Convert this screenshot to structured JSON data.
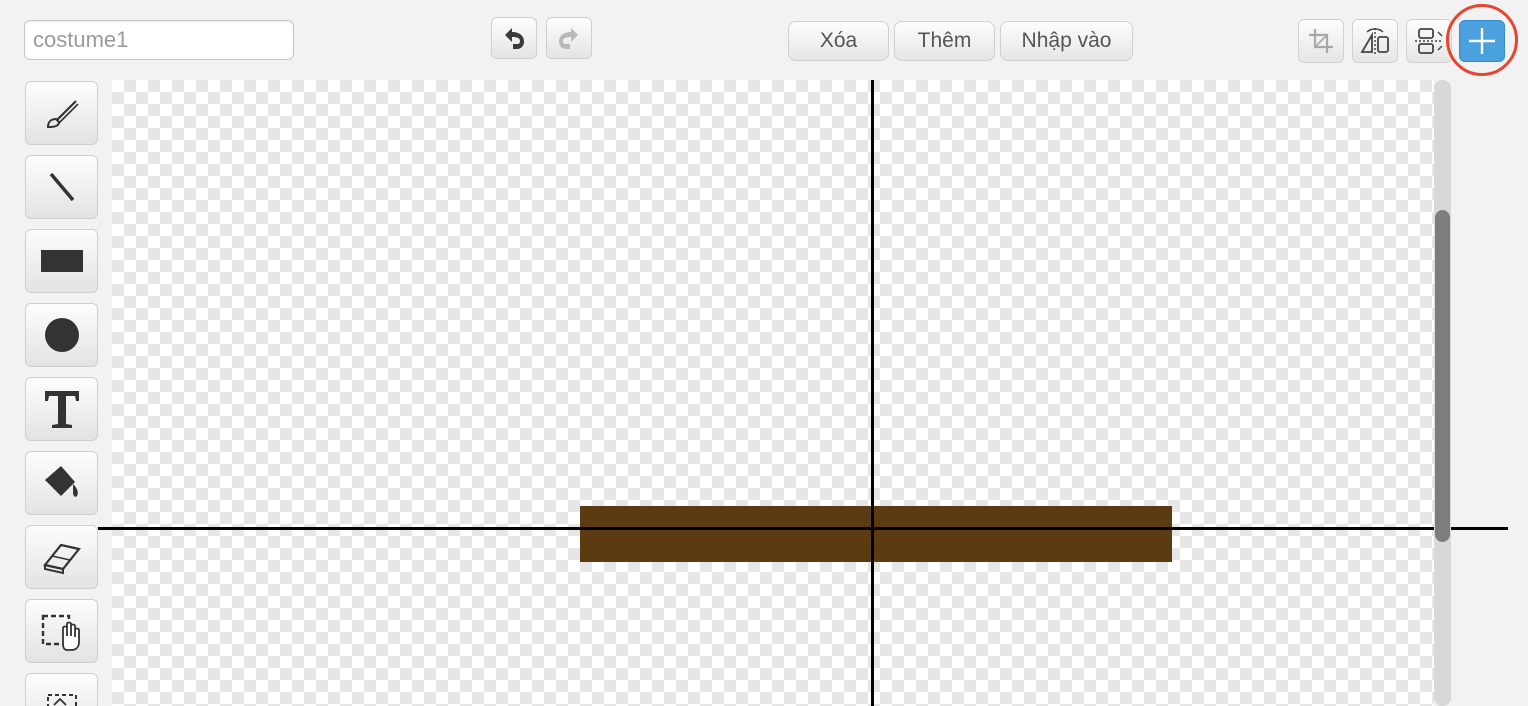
{
  "costume": {
    "name_value": "costume1",
    "name_placeholder": "costume1"
  },
  "history": {
    "undo_icon": "undo-arrow-icon",
    "redo_icon": "redo-arrow-icon"
  },
  "actions": {
    "clear_label": "Xóa",
    "add_label": "Thêm",
    "import_label": "Nhập vào"
  },
  "transform_tools": {
    "crop_icon": "crop-icon",
    "flip_horizontal_icon": "flip-horizontal-icon",
    "flip_vertical_icon": "flip-vertical-icon",
    "set_center_icon": "crosshair-icon",
    "set_center_active": true
  },
  "drawing_tools": [
    {
      "name": "brush",
      "icon": "paintbrush-icon"
    },
    {
      "name": "line",
      "icon": "line-icon"
    },
    {
      "name": "rectangle",
      "icon": "rectangle-icon"
    },
    {
      "name": "ellipse",
      "icon": "ellipse-icon"
    },
    {
      "name": "text",
      "icon": "text-icon",
      "glyph": "T"
    },
    {
      "name": "fill",
      "icon": "paint-bucket-icon"
    },
    {
      "name": "eraser",
      "icon": "eraser-icon"
    },
    {
      "name": "select",
      "icon": "select-hand-icon"
    },
    {
      "name": "stamp",
      "icon": "stamp-icon"
    }
  ],
  "colors": {
    "active_button": "#4ba0de",
    "highlight_ring": "#e8442f",
    "sprite_fill": "#5c3a12",
    "axis": "#000000"
  }
}
